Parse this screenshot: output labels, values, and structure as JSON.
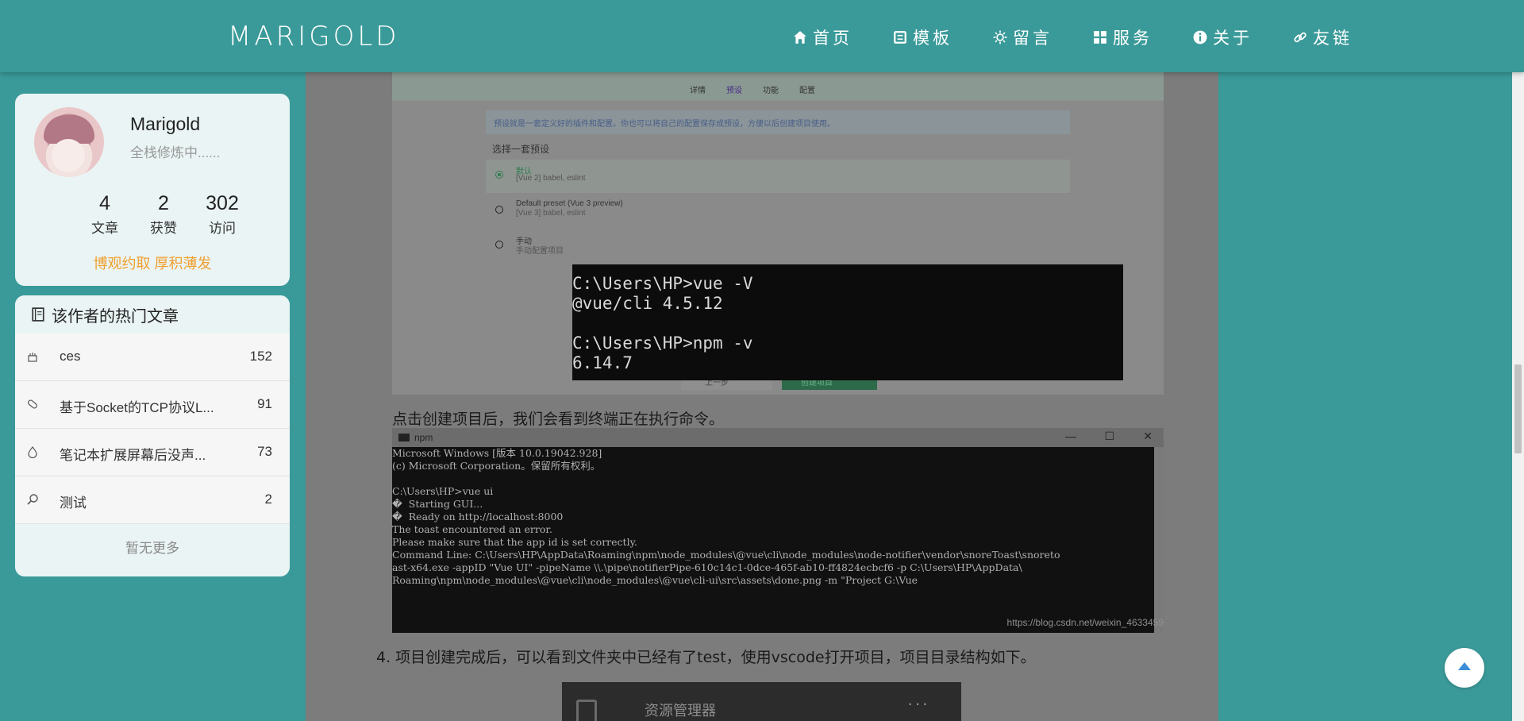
{
  "header": {
    "logo": "MARIGOLD",
    "nav": [
      {
        "label": "首页",
        "icon": "home-icon"
      },
      {
        "label": "模板",
        "icon": "template-icon"
      },
      {
        "label": "留言",
        "icon": "sun-icon"
      },
      {
        "label": "服务",
        "icon": "grid-icon"
      },
      {
        "label": "关于",
        "icon": "info-icon"
      },
      {
        "label": "友链",
        "icon": "link-icon"
      }
    ]
  },
  "profile": {
    "name": "Marigold",
    "desc": "全栈修炼中......",
    "stats": [
      {
        "num": "4",
        "label": "文章"
      },
      {
        "num": "2",
        "label": "获赞"
      },
      {
        "num": "302",
        "label": "访问"
      }
    ],
    "motto": "博观约取 厚积薄发"
  },
  "hot": {
    "title": "该作者的热门文章",
    "items": [
      {
        "title": "ces",
        "count": "152",
        "icon": "cake-icon"
      },
      {
        "title": "基于Socket的TCP协议L...",
        "count": "91",
        "icon": "pill-icon"
      },
      {
        "title": "笔记本扩展屏幕后没声...",
        "count": "73",
        "icon": "drop-icon"
      },
      {
        "title": "测试",
        "count": "2",
        "icon": "search-icon"
      }
    ],
    "more": "暂无更多"
  },
  "article": {
    "shot1": {
      "tabs": [
        "详情",
        "预设",
        "功能",
        "配置"
      ],
      "info": "预设就是一套定义好的插件和配置。你也可以将自己的配置保存成预设，方便以后创建项目使用。",
      "select_title": "选择一套预设",
      "options": [
        {
          "t1": "默认",
          "t2": "[Vue 2] babel, eslint"
        },
        {
          "t1": "Default preset (Vue 3 preview)",
          "t2": "[Vue 3] babel, eslint"
        },
        {
          "t1": "手动",
          "t2": "手动配置项目"
        }
      ],
      "back": "上一步",
      "create": "创建项目"
    },
    "terminal": "C:\\Users\\HP>vue -V\n@vue/cli 4.5.12\n\nC:\\Users\\HP>npm -v\n6.14.7",
    "caption1": "点击创建项目后，我们会看到终端正在执行命令。",
    "npm": {
      "title": "npm",
      "body": "Microsoft Windows [版本 10.0.19042.928]\n(c) Microsoft Corporation。保留所有权利。\n\nC:\\Users\\HP>vue ui\n�  Starting GUI...\n�  Ready on http://localhost:8000\nThe toast encountered an error.\nPlease make sure that the app id is set correctly.\nCommand Line: C:\\Users\\HP\\AppData\\Roaming\\npm\\node_modules\\@vue\\cli\\node_modules\\node-notifier\\vendor\\snoreToast\\snoreto\nast-x64.exe -appID \"Vue UI\" -pipeName \\\\.\\pipe\\notifierPipe-610c14c1-0dce-465f-ab10-ff4824ecbcf6 -p C:\\Users\\HP\\AppData\\\nRoaming\\npm\\node_modules\\@vue\\cli\\node_modules\\@vue\\cli-ui\\src\\assets\\done.png -m \"Project G:\\Vue",
      "watermark": "https://blog.csdn.net/weixin_4633459"
    },
    "caption2": "4. 项目创建完成后，可以看到文件夹中已经有了test，使用vscode打开项目，项目目录结构如下。",
    "shot3_label": "资源管理器",
    "shot3_dots": "···"
  },
  "colors": {
    "bg": "#3a9a99",
    "accent": "#f0a030"
  }
}
